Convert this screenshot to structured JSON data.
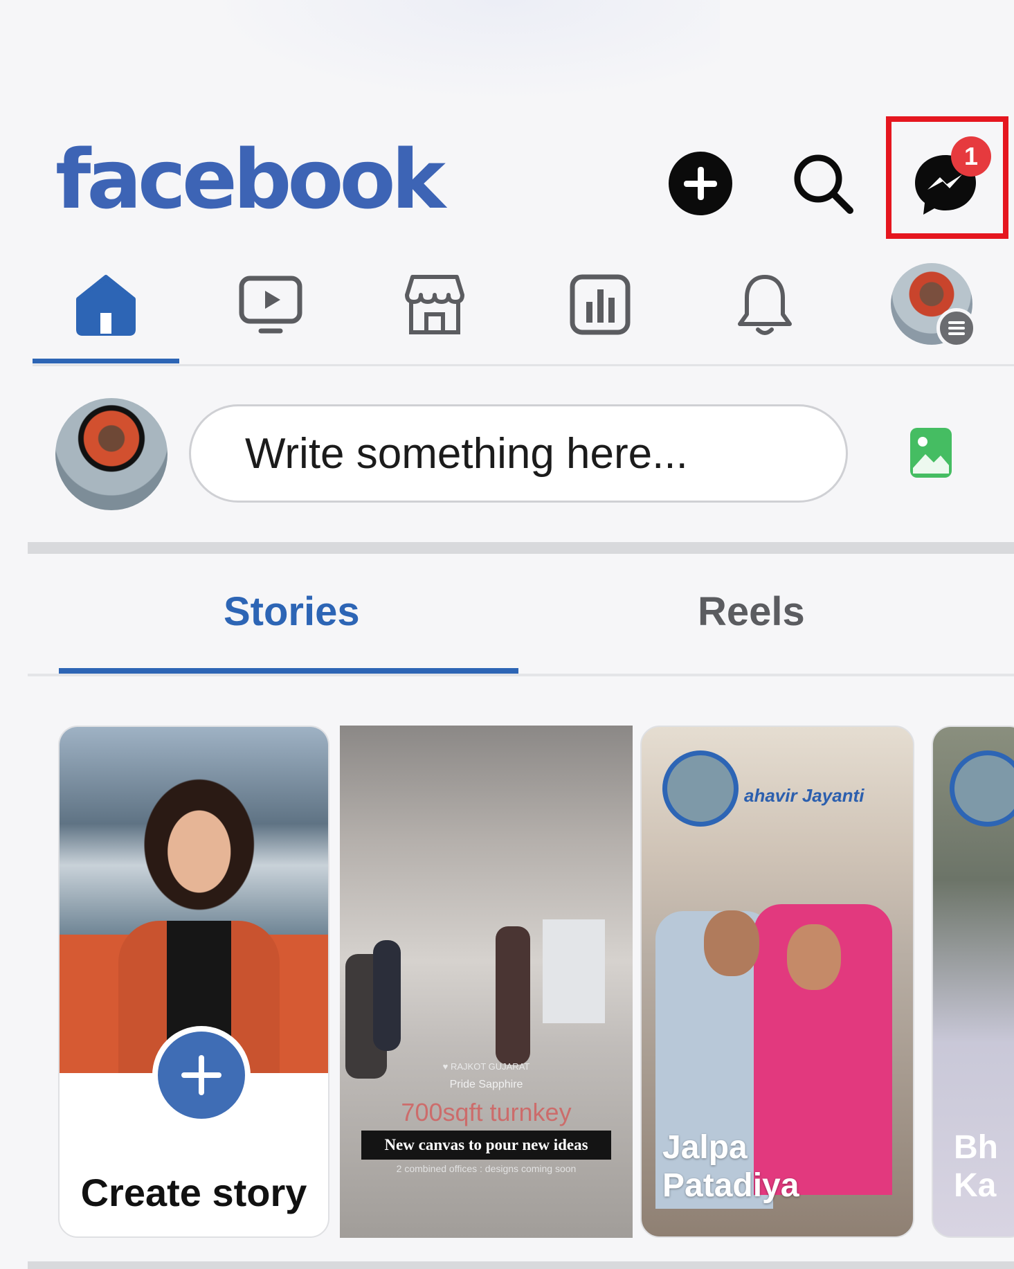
{
  "header": {
    "logo": "facebook",
    "messenger_badge": "1"
  },
  "nav": {
    "items": [
      "home",
      "video",
      "marketplace",
      "feeds",
      "notifications",
      "menu"
    ],
    "active": "home"
  },
  "composer": {
    "placeholder": "Write something here..."
  },
  "tabs": {
    "stories": "Stories",
    "reels": "Reels",
    "active": "Stories"
  },
  "stories": {
    "create_label": "Create story",
    "card2": {
      "location": "♥ RAJKOT GUJARAT",
      "name": "Pride Sapphire",
      "headline": "700sqft turnkey",
      "caption": "New canvas to pour new ideas",
      "subcaption": "2 combined offices : designs coming soon"
    },
    "card3": {
      "tag": "ahavir Jayanti",
      "name_line1": "Jalpa",
      "name_line2": "Patadiya"
    },
    "card4": {
      "name_line1": "Bh",
      "name_line2": "Ka"
    }
  },
  "colors": {
    "brand_blue": "#3d64b5",
    "active_blue": "#2d65b5",
    "highlight_red": "#e5161f",
    "badge_red": "#e63a3e",
    "photo_green": "#45bd62"
  }
}
